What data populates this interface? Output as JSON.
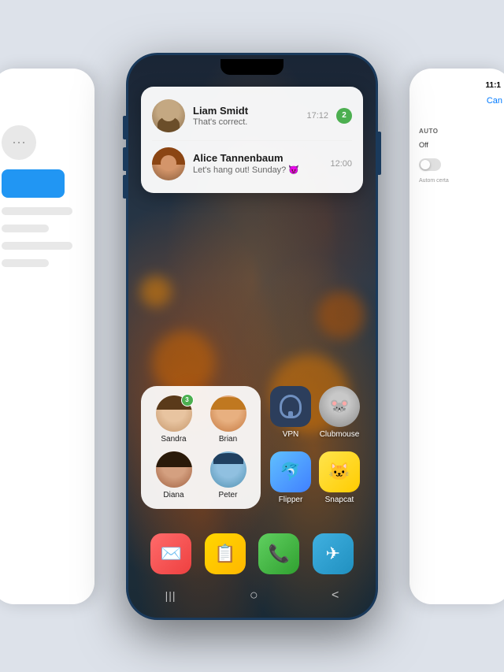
{
  "scene": {
    "bg_color": "#dde2ea"
  },
  "left_phone": {
    "visible": true
  },
  "right_phone": {
    "time": "11:1",
    "cancel_label": "Can",
    "section_title": "AUTO",
    "option_off": "Off",
    "toggle_desc": "Autom\ncerta"
  },
  "center_phone": {
    "notification_card": {
      "contact1": {
        "name": "Liam Smidt",
        "message": "That's correct.",
        "time": "17:12",
        "badge": "2"
      },
      "contact2": {
        "name": "Alice Tannenbaum",
        "message": "Let's hang out! Sunday? 😈",
        "time": "12:00"
      }
    },
    "contacts_widget": {
      "contacts": [
        {
          "name": "Sandra",
          "badge": "3"
        },
        {
          "name": "Brian",
          "badge": ""
        },
        {
          "name": "Diana",
          "badge": ""
        },
        {
          "name": "Peter",
          "badge": ""
        }
      ]
    },
    "apps": [
      {
        "name": "VPN",
        "type": "vpn"
      },
      {
        "name": "Clubmouse",
        "type": "clubmouse"
      },
      {
        "name": "Flipper",
        "type": "flipper"
      },
      {
        "name": "Snapcat",
        "type": "snapcat"
      }
    ],
    "dock": [
      {
        "name": "Mail",
        "type": "mail"
      },
      {
        "name": "Notes",
        "type": "notes"
      },
      {
        "name": "Phone",
        "type": "phone"
      },
      {
        "name": "Telegram",
        "type": "telegram"
      }
    ],
    "nav": {
      "back": "|||",
      "home": "○",
      "recent": "<"
    }
  }
}
